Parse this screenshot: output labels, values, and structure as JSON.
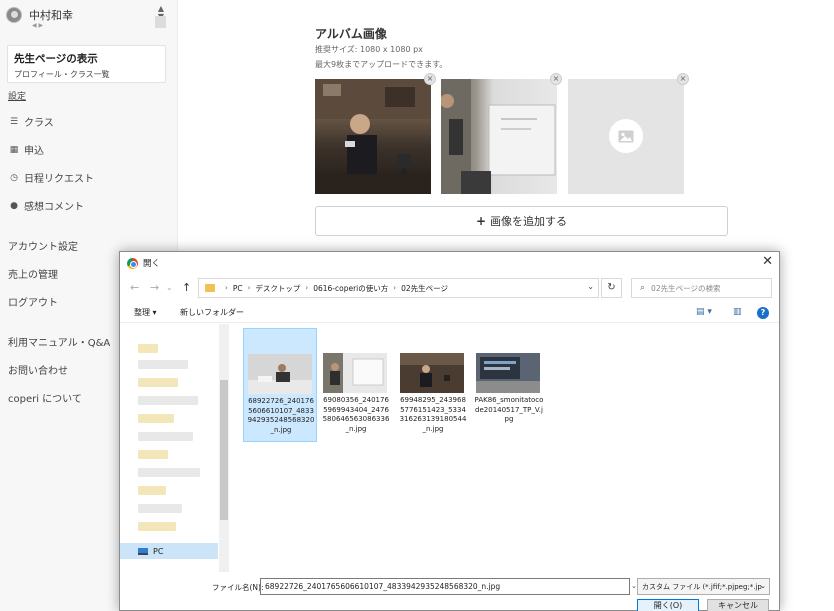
{
  "sidebar": {
    "user_name": "中村和幸",
    "page_card": {
      "title": "先生ページの表示",
      "subtitle": "プロフィール・クラス一覧"
    },
    "settings_label": "設定",
    "nav_items": [
      {
        "label": "クラス",
        "icon": "list-icon"
      },
      {
        "label": "申込",
        "icon": "calendar-icon"
      },
      {
        "label": "日程リクエスト",
        "icon": "clock-icon"
      },
      {
        "label": "感想コメント",
        "icon": "comment-icon"
      }
    ],
    "plain_items": [
      "アカウント設定",
      "売上の管理",
      "ログアウト",
      "利用マニュアル・Q&A",
      "お問い合わせ",
      "coperi について"
    ]
  },
  "album": {
    "title": "アルバム画像",
    "recommended_size": "推奨サイズ: 1080 x 1080 px",
    "upload_limit": "最大9枚までアップロードできます。",
    "add_button_label": "画像を追加する"
  },
  "dialog": {
    "title": "開く",
    "breadcrumbs": [
      "PC",
      "デスクトップ",
      "0616-coperiの使い方",
      "02先生ページ"
    ],
    "search_placeholder": "02先生ページの検索",
    "organize_label": "整理",
    "new_folder_label": "新しいフォルダー",
    "nav_selected": "PC",
    "files": [
      {
        "name": "68922726_2401765606610107_4833942935248568320_n.jpg",
        "selected": true
      },
      {
        "name": "69080356_2401765969943404_2476580646563086336_n.jpg",
        "selected": false
      },
      {
        "name": "69948295_2439685776151423_5334316263139180544_n.jpg",
        "selected": false
      },
      {
        "name": "PAK86_smonitatocode20140517_TP_V.jpg",
        "selected": false
      }
    ],
    "filename_label": "ファイル名(N):",
    "filename_value": "68922726_2401765606610107_4833942935248568320_n.jpg",
    "file_type_filter": "カスタム ファイル (*.jfif;*.pjpeg;*.jp",
    "open_button": "開く(O)",
    "cancel_button": "キャンセル"
  },
  "colors": {
    "accent_blue": "#0078d7",
    "selection": "#cce8ff",
    "sidebar_bg": "#f7f7f7"
  }
}
